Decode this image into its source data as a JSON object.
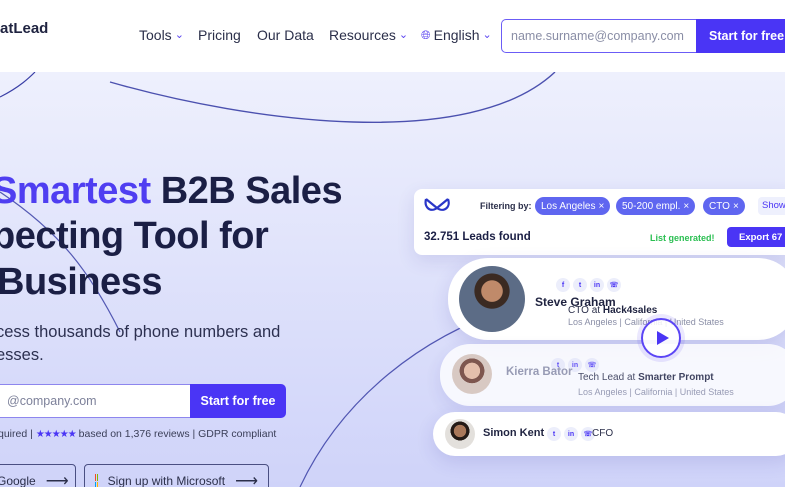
{
  "nav": {
    "logo": "atLead",
    "items": [
      {
        "label": "Tools",
        "has_dropdown": true
      },
      {
        "label": "Pricing",
        "has_dropdown": false
      },
      {
        "label": "Our Data",
        "has_dropdown": false
      },
      {
        "label": "Resources",
        "has_dropdown": true
      }
    ],
    "language": {
      "label": "English",
      "icon": "globe-icon"
    },
    "email_placeholder": "name.surname@company.com",
    "cta_label": "Start for free"
  },
  "hero": {
    "headline_line1_accent": "Smartest",
    "headline_line1_rest": " B2B Sales",
    "headline_line2": "pecting Tool for",
    "headline_line3": "Business",
    "subtitle_line1": "cess thousands of phone numbers and",
    "subtitle_line2": "esses.",
    "email_placeholder": "@company.com",
    "cta_label": "Start for free",
    "trust_prefix": "quired |",
    "stars": "★★★★★",
    "trust_suffix": "based on 1,376 reviews | GDPR compliant",
    "google_button": "Google",
    "microsoft_button": "Sign up with Microsoft"
  },
  "product": {
    "filter_label": "Filtering by:",
    "chips": [
      "Los Angeles",
      "50-200 empl.",
      "CTO"
    ],
    "show_label": "Show",
    "leads_found": "32.751 Leads found",
    "generated": "List generated!",
    "export_label": "Export 67",
    "people": [
      {
        "name": "Steve Graham",
        "role_prefix": "CTO",
        "at": "at",
        "company": "Hack4sales",
        "location": "Los Angeles | California | United States"
      },
      {
        "name": "Kierra Bator",
        "role_prefix": "Tech Lead",
        "at": "at",
        "company": "Smarter Prompt",
        "location": "Los Angeles | California | United States"
      },
      {
        "name": "Simon Kent",
        "role_prefix": "CFO",
        "at": "",
        "company": "",
        "location": ""
      }
    ]
  },
  "colors": {
    "accent": "#4a35f5",
    "chip": "#5f66f0",
    "success": "#2bbf52"
  }
}
